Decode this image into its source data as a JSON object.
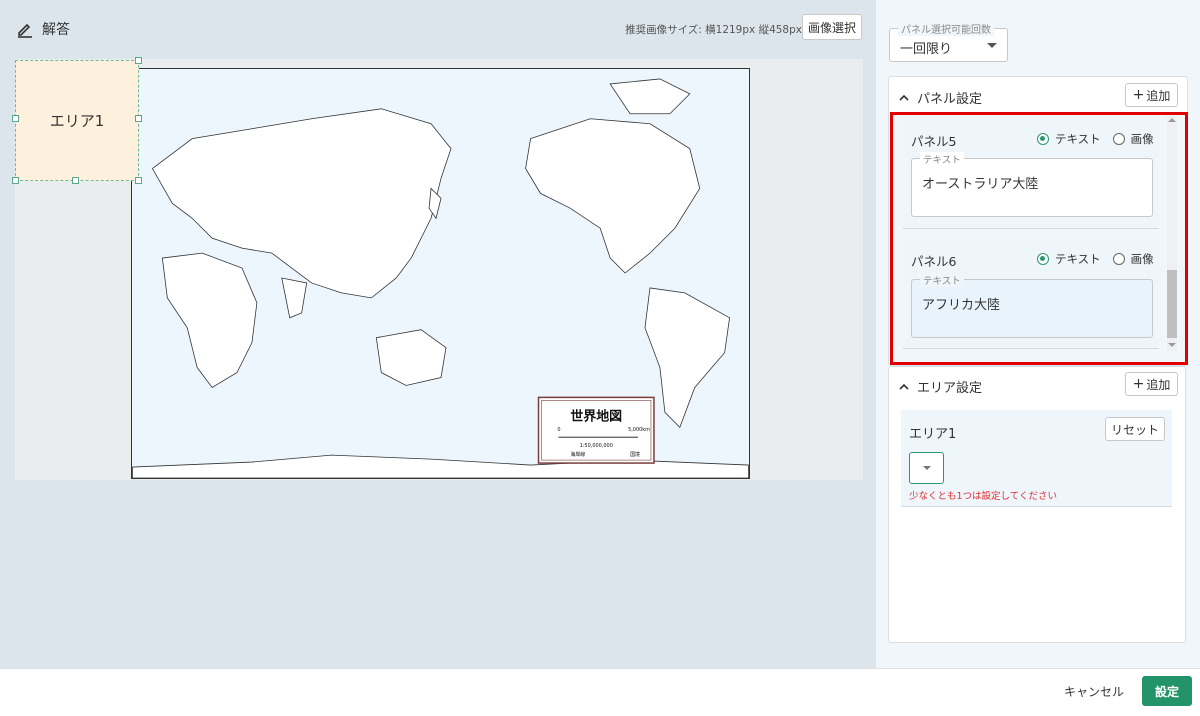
{
  "header": {
    "title": "解答",
    "recommended_size": "推奨画像サイズ: 横1219px 縦458px",
    "image_select_label": "画像選択"
  },
  "canvas": {
    "area_label": "エリア1",
    "map": {
      "title": "世界地図",
      "scale_zero": "0",
      "scale_max": "5,000km",
      "scale_ratio": "1:50,000,000",
      "legend_coastline": "海岸線",
      "legend_border": "国境"
    }
  },
  "sidebar": {
    "selection_count": {
      "label": "パネル選択可能回数",
      "value": "一回限り"
    },
    "panel_settings": {
      "title": "パネル設定",
      "add_label": "追加",
      "panels": [
        {
          "label": "パネル5",
          "option_text": "テキスト",
          "option_image": "画像",
          "selected": "text",
          "field_label": "テキスト",
          "value": "オーストラリア大陸"
        },
        {
          "label": "パネル6",
          "option_text": "テキスト",
          "option_image": "画像",
          "selected": "text",
          "field_label": "テキスト",
          "value": "アフリカ大陸"
        }
      ]
    },
    "area_settings": {
      "title": "エリア設定",
      "add_label": "追加",
      "areas": [
        {
          "label": "エリア1",
          "reset_label": "リセット",
          "error": "少なくとも1つは設定してください"
        }
      ]
    }
  },
  "footer": {
    "cancel_label": "キャンセル",
    "ok_label": "設定"
  },
  "colors": {
    "accent": "#23946a",
    "highlight_border": "#e00000",
    "error": "#e03030",
    "area_fill": "#fdf0dc"
  }
}
